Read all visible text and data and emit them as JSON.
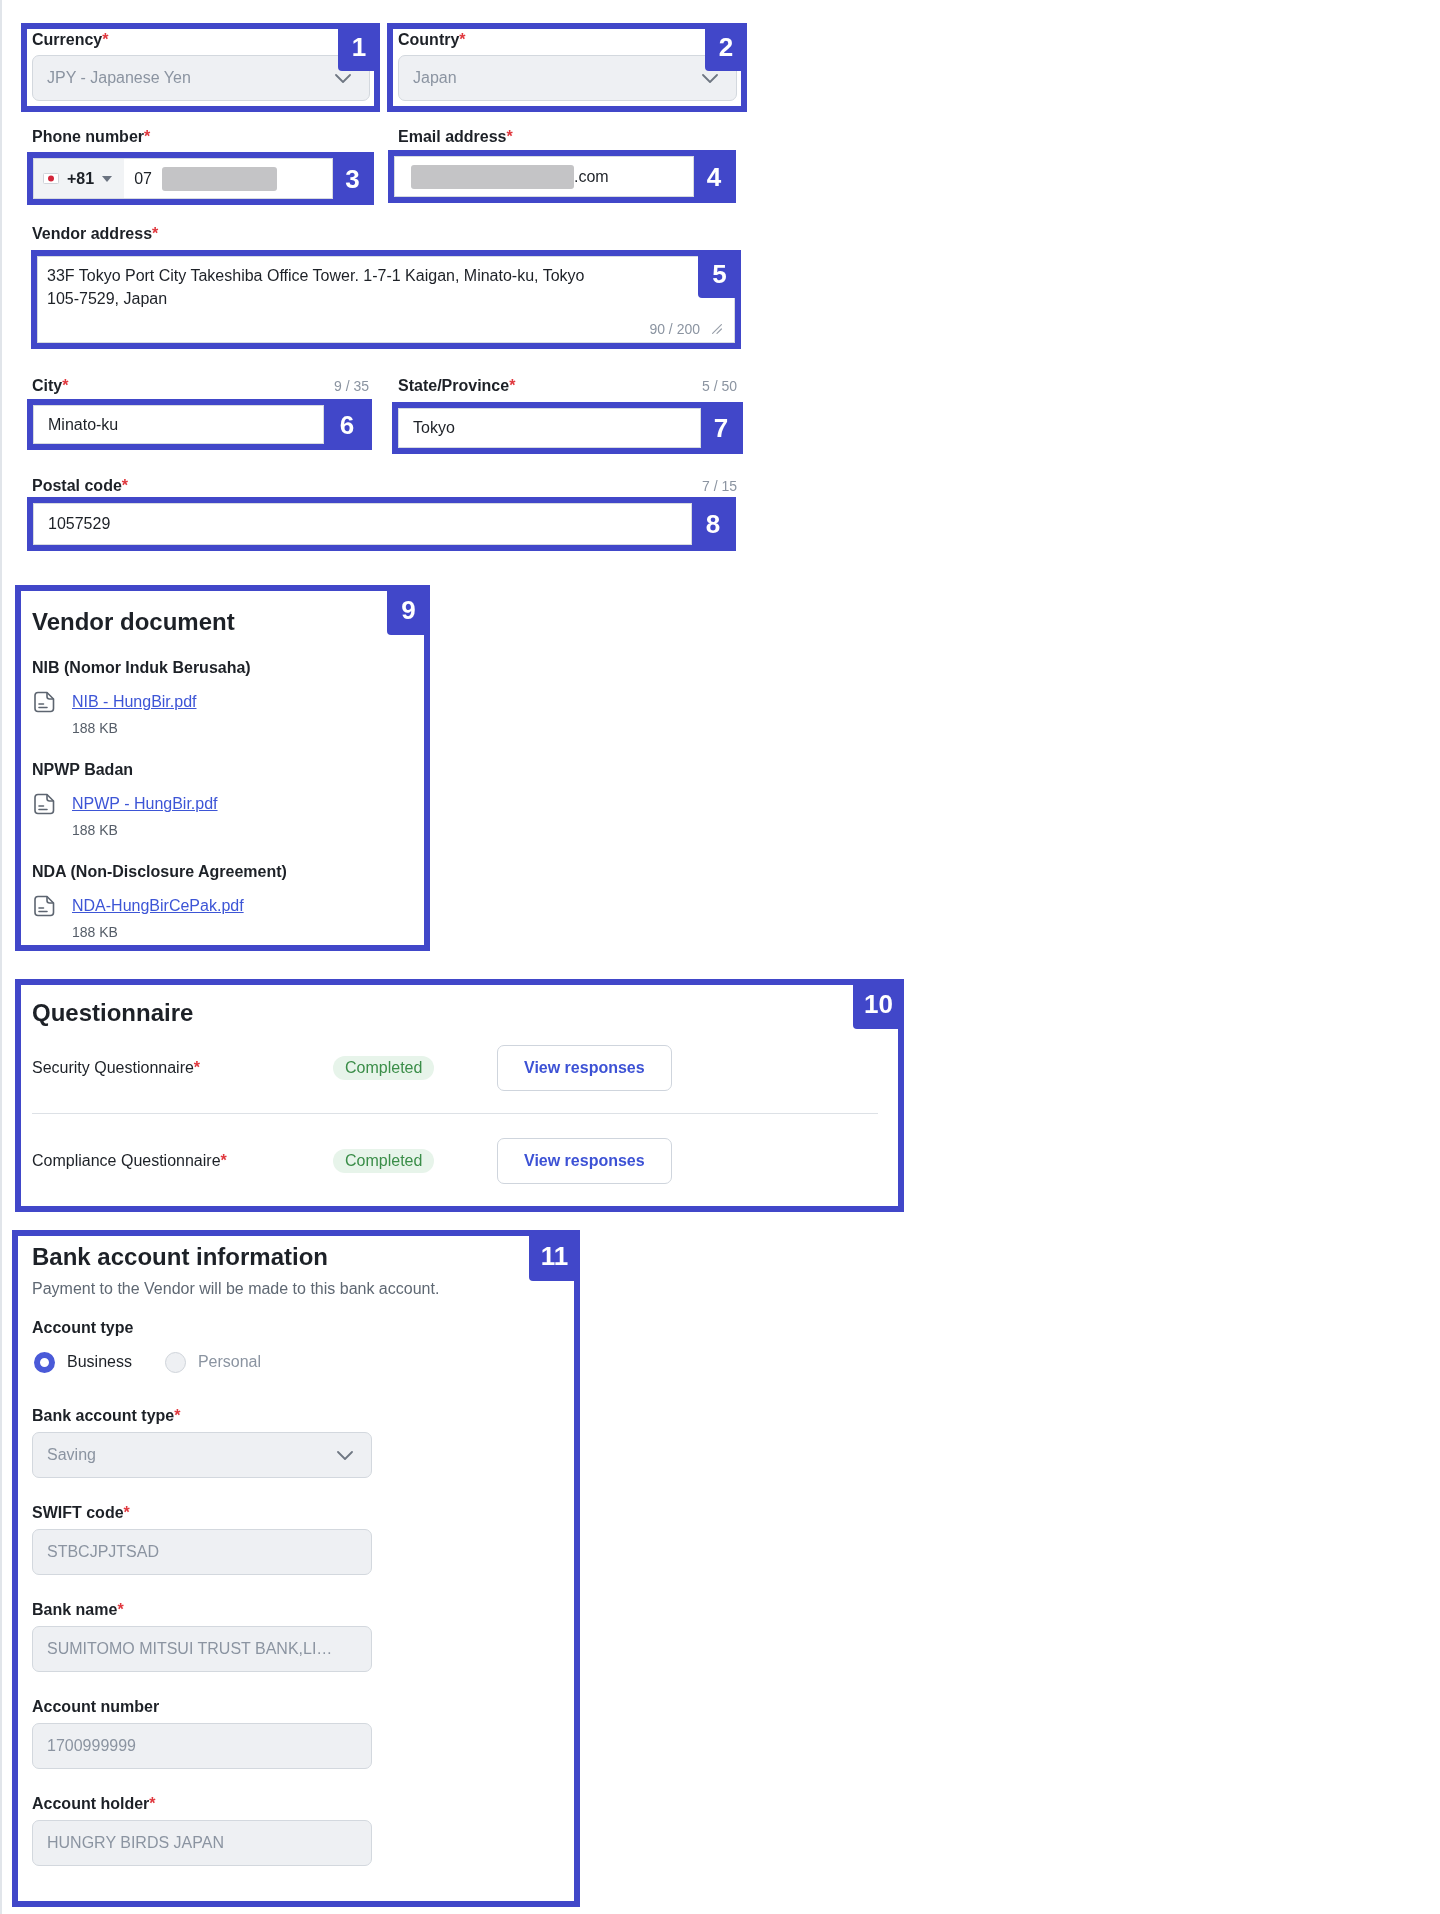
{
  "vendor_details": {
    "currency": {
      "label": "Currency",
      "required_mark": "*",
      "value": "JPY - Japanese Yen",
      "disabled": true,
      "annotation": "1"
    },
    "country": {
      "label": "Country",
      "required_mark": "*",
      "value": "Japan",
      "disabled": true,
      "annotation": "2"
    },
    "phone": {
      "label": "Phone number",
      "required_mark": "*",
      "dial_code": "+81",
      "value": "07",
      "redacted": true,
      "disabled": false,
      "annotation": "3"
    },
    "email": {
      "label": "Email address",
      "required_mark": "*",
      "value": ".com",
      "redacted": true,
      "disabled": false,
      "annotation": "4"
    },
    "vendor_address": {
      "label": "Vendor address",
      "required_mark": "*",
      "value": "33F Tokyo Port City Takeshiba Office Tower. 1-7-1 Kaigan, Minato-ku, Tokyo 105-7529, Japan",
      "counter": "90 / 200",
      "disabled": false,
      "annotation": "5"
    },
    "city": {
      "label": "City",
      "required_mark": "*",
      "counter": "9 / 35",
      "value": "Minato-ku",
      "disabled": false,
      "annotation": "6"
    },
    "state": {
      "label": "State/Province",
      "required_mark": "*",
      "counter": "5 / 50",
      "value": "Tokyo",
      "disabled": false,
      "annotation": "7"
    },
    "postal_code": {
      "label": "Postal code",
      "required_mark": "*",
      "counter": "7 / 15",
      "value": "1057529",
      "disabled": false,
      "annotation": "8"
    }
  },
  "vendor_document": {
    "title": "Vendor document",
    "annotation": "9",
    "documents": [
      {
        "label": "NIB (Nomor Induk Berusaha)",
        "file": "NIB - HungBir.pdf",
        "size": "188 KB"
      },
      {
        "label": "NPWP Badan",
        "file": "NPWP - HungBir.pdf",
        "size": "188 KB"
      },
      {
        "label": "NDA (Non-Disclosure Agreement)",
        "file": "NDA-HungBirCePak.pdf",
        "size": "188 KB"
      }
    ]
  },
  "questionnaire": {
    "title": "Questionnaire",
    "annotation": "10",
    "items": [
      {
        "label": "Security Questionnaire",
        "required_mark": "*",
        "status": "Completed",
        "action": "View responses"
      },
      {
        "label": "Compliance Questionnaire",
        "required_mark": "*",
        "status": "Completed",
        "action": "View responses"
      }
    ]
  },
  "bank_account": {
    "title": "Bank account information",
    "subtitle": "Payment to the Vendor will be made to this bank account.",
    "annotation": "11",
    "account_type": {
      "label": "Account type",
      "options": [
        {
          "label": "Business",
          "selected": true,
          "disabled": false
        },
        {
          "label": "Personal",
          "selected": false,
          "disabled": true
        }
      ]
    },
    "fields": [
      {
        "kind": "select",
        "label": "Bank account type",
        "required_mark": "*",
        "value": "Saving",
        "disabled": true
      },
      {
        "kind": "text",
        "label": "SWIFT code",
        "required_mark": "*",
        "value": "STBCJPJTSAD",
        "disabled": true
      },
      {
        "kind": "text",
        "label": "Bank name",
        "required_mark": "*",
        "value": "SUMITOMO MITSUI TRUST BANK,LI…",
        "disabled": true
      },
      {
        "kind": "text",
        "label": "Account number",
        "value": "1700999999",
        "disabled": true
      },
      {
        "kind": "text",
        "label": "Account holder",
        "required_mark": "*",
        "value": "HUNGRY BIRDS JAPAN",
        "disabled": true
      }
    ]
  }
}
